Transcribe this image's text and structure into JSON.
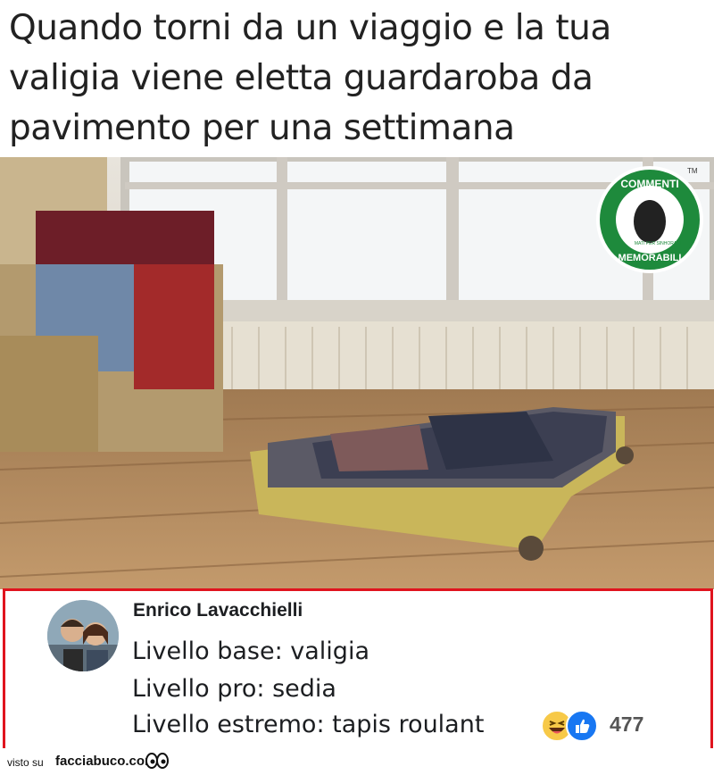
{
  "title": {
    "lines": [
      "Quando torni da un viaggio e la tua",
      "valigia viene eletta guardaroba da",
      "pavimento per una settimana"
    ]
  },
  "watermark": {
    "top": "COMMENTI",
    "bottom": "MEMORABILI",
    "center": "MATI PER SINHORARE",
    "tm": "TM",
    "color": "#1e8a3c"
  },
  "comment": {
    "author": "Enrico Lavacchielli",
    "lines": [
      "Livello base: valigia",
      "Livello pro: sedia",
      "Livello estremo: tapis roulant"
    ],
    "reaction_icons": [
      "haha-icon",
      "like-icon"
    ],
    "reaction_count": "477",
    "border_color": "#e0141e"
  },
  "footer": {
    "visto": "visto su",
    "site": "facciabuco.com"
  }
}
